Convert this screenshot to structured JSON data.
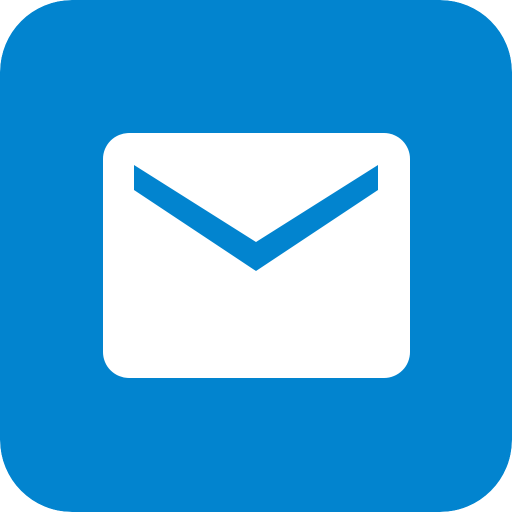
{
  "icon": {
    "name": "mail-icon",
    "background_color": "#0284CF",
    "envelope_color": "#FFFFFF",
    "flap_color": "#0284CF"
  }
}
